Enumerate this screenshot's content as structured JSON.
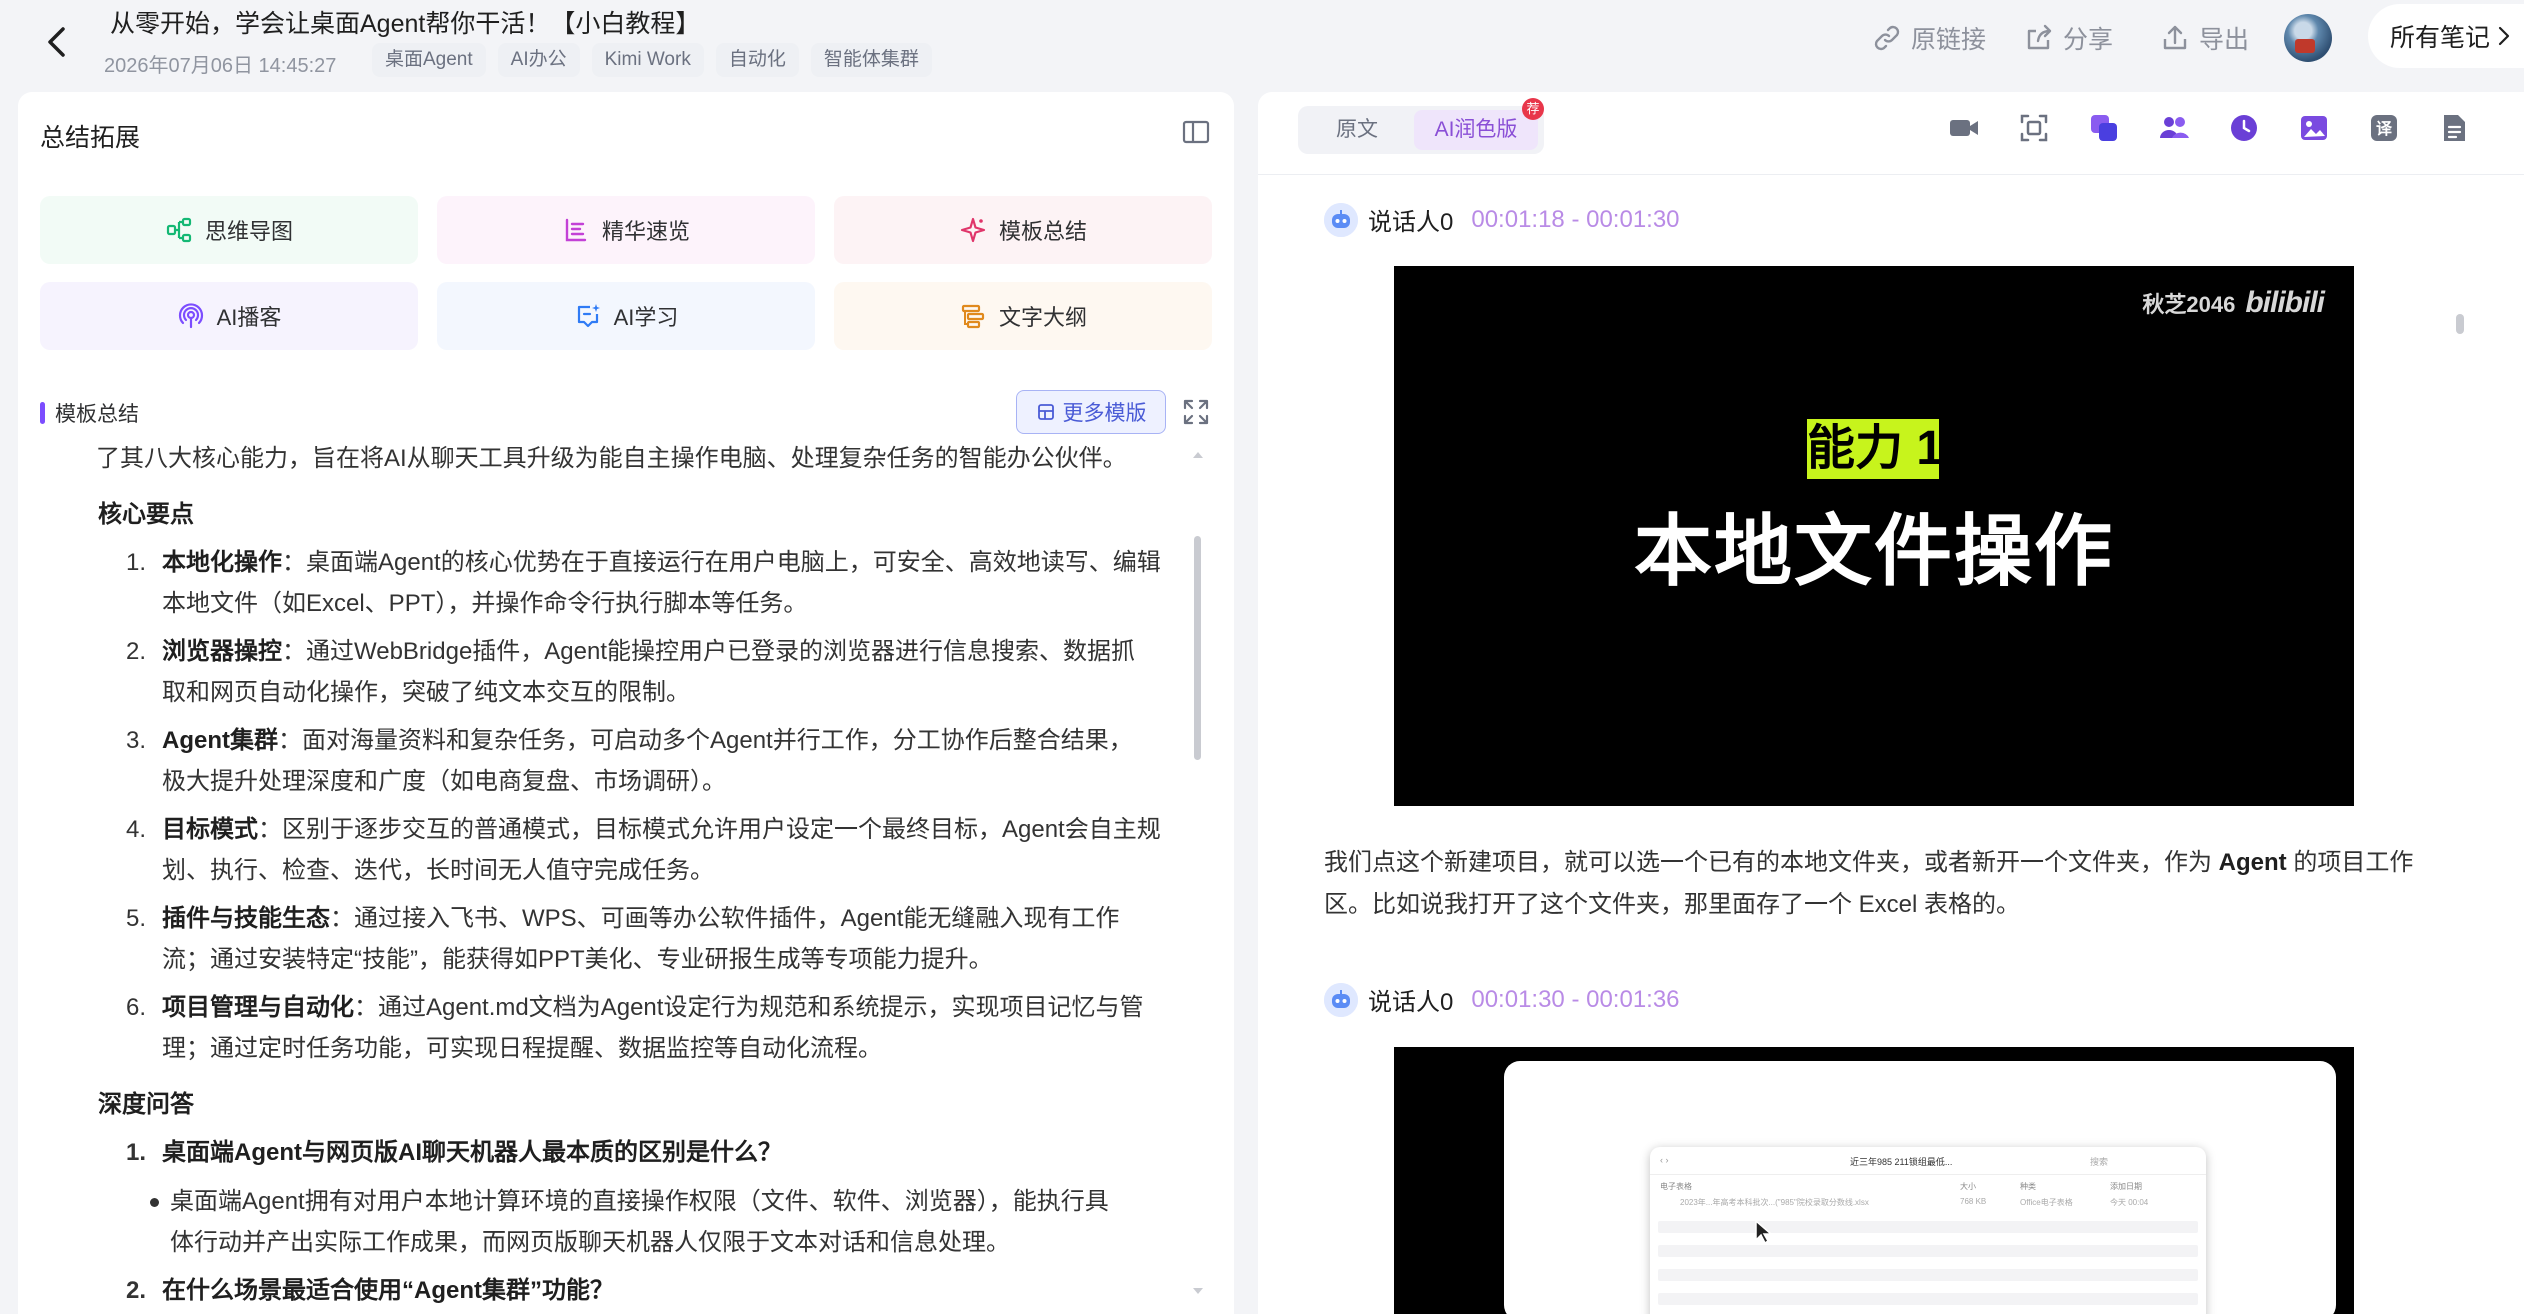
{
  "header": {
    "title": "从零开始，学会让桌面Agent帮你干活！【小白教程】",
    "date": "2026年07月06日 14:45:27",
    "tags": [
      "桌面Agent",
      "AI办公",
      "Kimi Work",
      "自动化",
      "智能体集群"
    ],
    "actions": {
      "source_link": "原链接",
      "share": "分享",
      "export": "导出"
    },
    "all_notes": "所有笔记"
  },
  "left": {
    "panel_title": "总结拓展",
    "features": [
      {
        "label": "思维导图",
        "icon": "mindmap-icon",
        "color": "#14b874"
      },
      {
        "label": "精华速览",
        "icon": "list-icon",
        "color": "#c341d6"
      },
      {
        "label": "模板总结",
        "icon": "sparkle-icon",
        "color": "#e0356a"
      },
      {
        "label": "AI播客",
        "icon": "podcast-icon",
        "color": "#7c4dff"
      },
      {
        "label": "AI学习",
        "icon": "chat-sparkle-icon",
        "color": "#2f7bf5"
      },
      {
        "label": "文字大纲",
        "icon": "outline-icon",
        "color": "#e08a1e"
      }
    ],
    "section_label": "模板总结",
    "more_templates": "更多模版",
    "summary": {
      "intro": "了其八大核心能力，旨在将AI从聊天工具升级为能自主操作电脑、处理复杂任务的智能办公伙伴。",
      "core_heading": "核心要点",
      "core_points": [
        {
          "bold": "本地化操作",
          "text": "：桌面端Agent的核心优势在于直接运行在用户电脑上，可安全、高效地读写、编辑",
          "text2": "本地文件（如Excel、PPT），并操作命令行执行脚本等任务。"
        },
        {
          "bold": "浏览器操控",
          "text": "：通过WebBridge插件，Agent能操控用户已登录的浏览器进行信息搜索、数据抓",
          "text2": "取和网页自动化操作，突破了纯文本交互的限制。"
        },
        {
          "bold": "Agent集群",
          "text": "：面对海量资料和复杂任务，可启动多个Agent并行工作，分工协作后整合结果，",
          "text2": "极大提升处理深度和广度（如电商复盘、市场调研）。"
        },
        {
          "bold": "目标模式",
          "text": "：区别于逐步交互的普通模式，目标模式允许用户设定一个最终目标，Agent会自主规",
          "text2": "划、执行、检查、迭代，长时间无人值守完成任务。"
        },
        {
          "bold": "插件与技能生态",
          "text": "：通过接入飞书、WPS、可画等办公软件插件，Agent能无缝融入现有工作",
          "text2": "流；通过安装特定“技能”，能获得如PPT美化、专业研报生成等专项能力提升。"
        },
        {
          "bold": "项目管理与自动化",
          "text": "：通过Agent.md文档为Agent设定行为规范和系统提示，实现项目记忆与管",
          "text2": "理；通过定时任务功能，可实现日程提醒、数据监控等自动化流程。"
        }
      ],
      "qa_heading": "深度问答",
      "qa": [
        {
          "q": "桌面端Agent与网页版AI聊天机器人最本质的区别是什么？",
          "a": "桌面端Agent拥有对用户本地计算环境的直接操作权限（文件、软件、浏览器），能执行具",
          "a2": "体行动并产出实际工作成果，而网页版聊天机器人仅限于文本对话和信息处理。"
        },
        {
          "q": "在什么场景最适合使用“Agent集群”功能？"
        }
      ]
    }
  },
  "right": {
    "tabs": {
      "original": "原文",
      "polished": "AI润色版",
      "badge": "荐"
    },
    "toolbar": [
      "video-icon",
      "screenshot-icon",
      "copy-icon",
      "speakers-icon",
      "clock-icon",
      "image-icon",
      "translate-icon",
      "document-icon"
    ],
    "toolbar_translate": "译",
    "blocks": [
      {
        "speaker": "说话人0",
        "time": "00:01:18 - 00:01:30",
        "frame": {
          "watermark_left": "秋芝2046",
          "watermark_logo": "bilibili",
          "label": "能力 1",
          "headline": "本地文件操作"
        }
      },
      {
        "speaker": "说话人0",
        "time": "00:01:30 - 00:01:36",
        "frame": {
          "folder_title": "近三年985 211锁组最低...",
          "search": "搜索",
          "col_name": "电子表格",
          "col_size": "大小",
          "col_kind": "种类",
          "col_date": "添加日期",
          "file_name": "2023年...年高考本科批次...(\"985\"院校录取分数线.xlsx",
          "file_size": "768 KB",
          "file_kind": "Office电子表格",
          "file_date": "今天 00:04"
        }
      }
    ],
    "paragraph": {
      "pre": "我们点这个新建项目，就可以选一个已有的本地文件夹，或者新开一个文件夹，作为 ",
      "bold": "Agent",
      "post": " 的项目工作",
      "line2": "区。比如说我打开了这个文件夹，那里面存了一个 Excel 表格的。"
    }
  }
}
